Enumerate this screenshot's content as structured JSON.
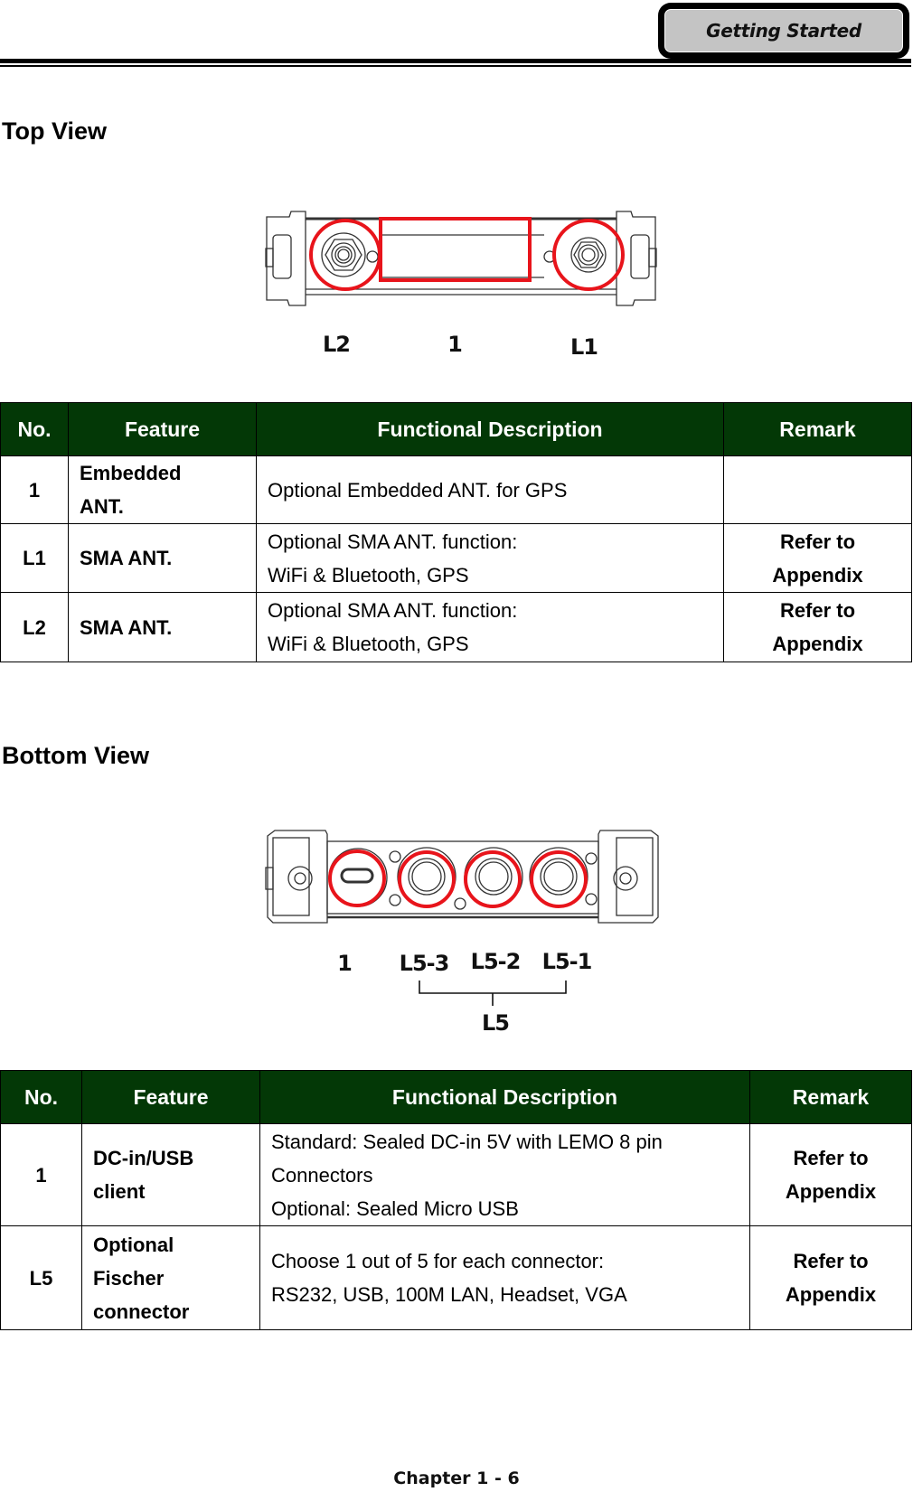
{
  "header": {
    "tab_label": "Getting Started"
  },
  "top_view": {
    "title": "Top View",
    "callouts": [
      "L2",
      "1",
      "L1"
    ],
    "table": {
      "headers": [
        "No.",
        "Feature",
        "Functional Description",
        "Remark"
      ],
      "rows": [
        {
          "no": "1",
          "feature": [
            "Embedded",
            "ANT."
          ],
          "description": [
            "Optional Embedded ANT. for GPS"
          ],
          "remark": []
        },
        {
          "no": "L1",
          "feature": [
            "SMA ANT."
          ],
          "description": [
            "Optional SMA ANT. function:",
            "WiFi & Bluetooth, GPS"
          ],
          "remark": [
            "Refer to",
            "Appendix"
          ]
        },
        {
          "no": "L2",
          "feature": [
            "SMA ANT."
          ],
          "description": [
            "Optional SMA ANT. function:",
            "WiFi & Bluetooth, GPS"
          ],
          "remark": [
            "Refer to",
            "Appendix"
          ]
        }
      ]
    }
  },
  "bottom_view": {
    "title": "Bottom View",
    "callouts": [
      "1",
      "L5-3",
      "L5-2",
      "L5-1"
    ],
    "group_label": "L5",
    "table": {
      "headers": [
        "No.",
        "Feature",
        "Functional Description",
        "Remark"
      ],
      "rows": [
        {
          "no": "1",
          "feature": [
            "DC-in/USB",
            "client"
          ],
          "description": [
            "Standard: Sealed DC-in 5V with LEMO 8 pin",
            "Connectors",
            "Optional: Sealed Micro USB"
          ],
          "remark": [
            "Refer to",
            "Appendix"
          ]
        },
        {
          "no": "L5",
          "feature": [
            "Optional",
            "Fischer",
            "connector"
          ],
          "description": [
            "Choose 1 out of 5 for each connector:",
            "RS232, USB, 100M LAN, Headset, VGA"
          ],
          "remark": [
            "Refer to",
            "Appendix"
          ]
        }
      ]
    }
  },
  "colors": {
    "table_header_bg": "#033806",
    "highlight": "#e8141b"
  },
  "footer": {
    "page_label": "Chapter 1 - 6"
  }
}
